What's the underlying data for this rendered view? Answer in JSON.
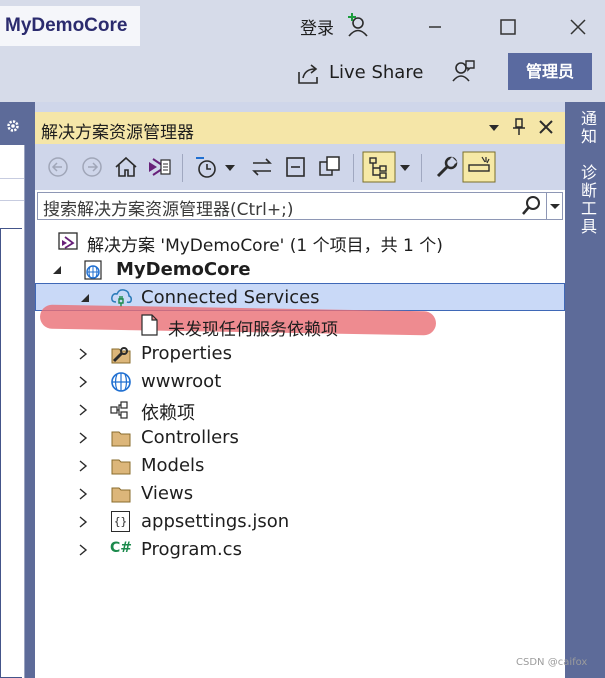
{
  "titlebar": {
    "project": "MyDemoCore",
    "login": "登录",
    "live_share": "Live Share",
    "admin": "管理员"
  },
  "panel": {
    "title": "解决方案资源管理器",
    "search_placeholder": "搜索解决方案资源管理器(Ctrl+;)"
  },
  "right_tabs": [
    "通知",
    "诊断工具"
  ],
  "tree": {
    "solution": "解决方案 'MyDemoCore' (1 个项目，共 1 个)",
    "project": "MyDemoCore",
    "connected_services": "Connected Services",
    "no_services": "未发现任何服务依赖项",
    "items": [
      "Properties",
      "wwwroot",
      "依赖项",
      "Controllers",
      "Models",
      "Views",
      "appsettings.json",
      "Program.cs"
    ],
    "csharp_glyph": "C#",
    "json_glyph": "{}"
  },
  "watermark": "CSDN @caifox",
  "colors": {
    "accent": "#5d6b99",
    "panel_header": "#f5e6a8",
    "selection": "#c9d9f7",
    "highlight_mark": "#ea6e74"
  }
}
